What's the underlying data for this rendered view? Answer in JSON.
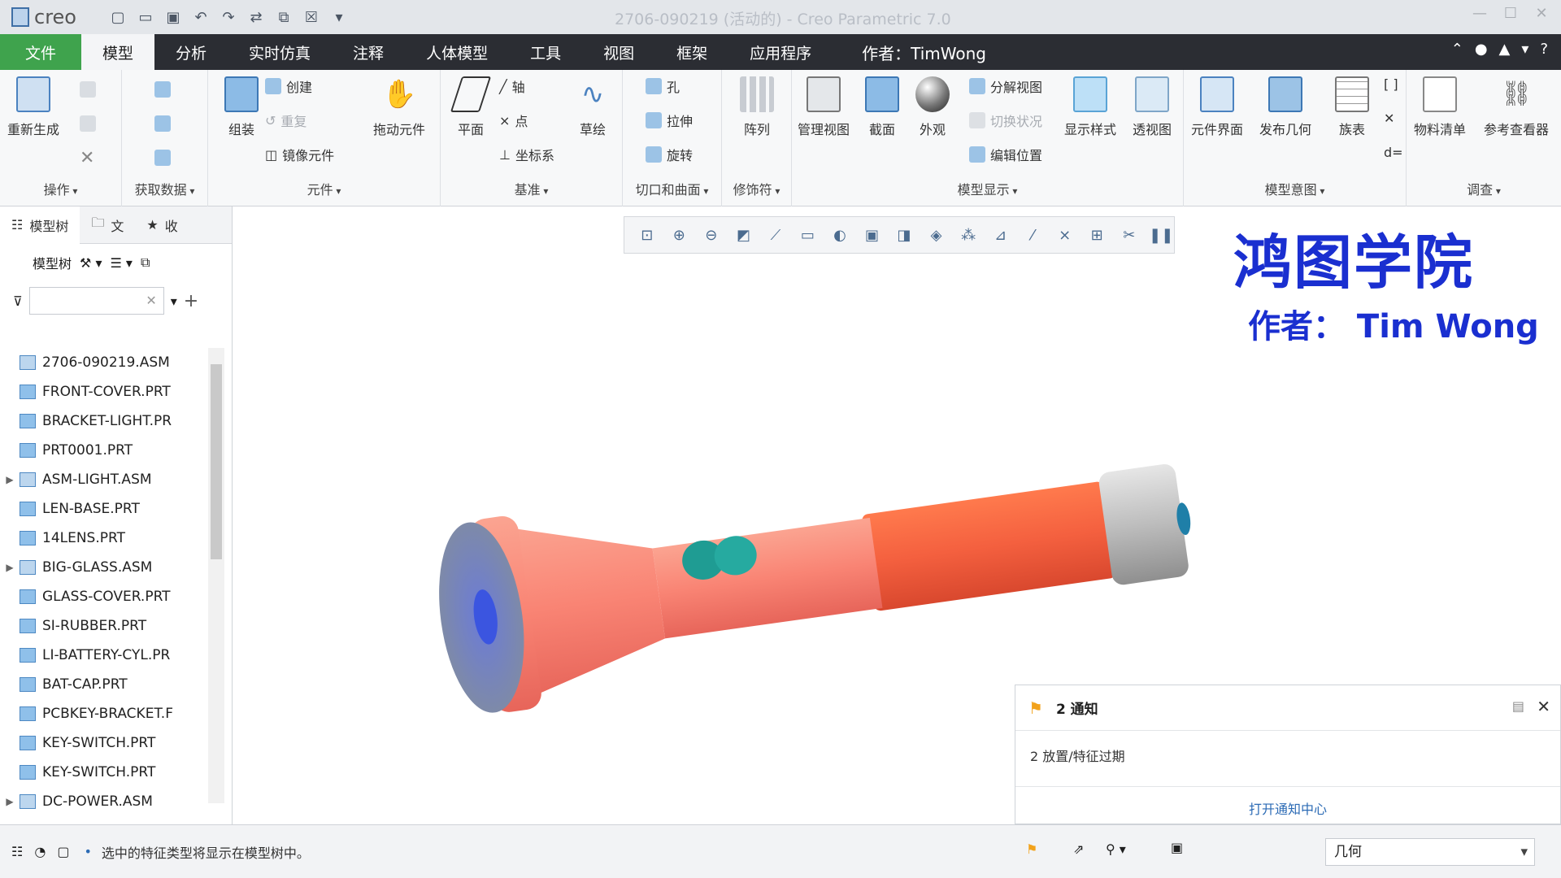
{
  "app": {
    "logo_text": "creo",
    "window_title": "2706-090219 (活动的) - Creo Parametric 7.0"
  },
  "menu": {
    "tabs": [
      "文件",
      "模型",
      "分析",
      "实时仿真",
      "注释",
      "人体模型",
      "工具",
      "视图",
      "框架",
      "应用程序"
    ],
    "author": "作者：TimWong"
  },
  "ribbon": {
    "groups": {
      "operations": {
        "label": "操作",
        "regenerate": "重新生成"
      },
      "get_data": {
        "label": "获取数据"
      },
      "component": {
        "label": "元件",
        "assemble": "组装",
        "create": "创建",
        "repeat": "重复",
        "mirror": "镜像元件",
        "drag": "拖动元件"
      },
      "datum": {
        "label": "基准",
        "plane": "平面",
        "axis": "轴",
        "point": "点",
        "csys": "坐标系",
        "sketch": "草绘"
      },
      "cut_surface": {
        "label": "切口和曲面",
        "hole": "孔",
        "extrude": "拉伸",
        "revolve": "旋转"
      },
      "modifier": {
        "label": "修饰符",
        "pattern": "阵列"
      },
      "model_display": {
        "label": "模型显示",
        "manage_views": "管理视图",
        "section": "截面",
        "appearance": "外观",
        "explode": "分解视图",
        "toggle_state": "切换状况",
        "edit_position": "编辑位置",
        "display_style": "显示样式",
        "perspective": "透视图"
      },
      "model_intent": {
        "label": "模型意图",
        "component_interface": "元件界面",
        "publish_geometry": "发布几何",
        "family_table": "族表"
      },
      "investigate": {
        "label": "调查",
        "bom": "物料清单",
        "reference_viewer": "参考查看器"
      }
    }
  },
  "left_panel": {
    "tabs": [
      "模型树",
      "文",
      "收"
    ],
    "toolbar_label": "模型树",
    "tree": [
      {
        "name": "2706-090219.ASM",
        "type": "asm",
        "expand": ""
      },
      {
        "name": "FRONT-COVER.PRT",
        "type": "prt",
        "expand": ""
      },
      {
        "name": "BRACKET-LIGHT.PR",
        "type": "prt",
        "expand": ""
      },
      {
        "name": "PRT0001.PRT",
        "type": "prt",
        "expand": ""
      },
      {
        "name": "ASM-LIGHT.ASM",
        "type": "asm",
        "expand": "▶"
      },
      {
        "name": "LEN-BASE.PRT",
        "type": "prt",
        "expand": ""
      },
      {
        "name": "14LENS.PRT",
        "type": "prt",
        "expand": ""
      },
      {
        "name": "BIG-GLASS.ASM",
        "type": "asm",
        "expand": "▶"
      },
      {
        "name": "GLASS-COVER.PRT",
        "type": "prt",
        "expand": ""
      },
      {
        "name": "SI-RUBBER.PRT",
        "type": "prt",
        "expand": ""
      },
      {
        "name": "LI-BATTERY-CYL.PR",
        "type": "prt",
        "expand": ""
      },
      {
        "name": "BAT-CAP.PRT",
        "type": "prt",
        "expand": ""
      },
      {
        "name": "PCBKEY-BRACKET.F",
        "type": "prt",
        "expand": ""
      },
      {
        "name": "KEY-SWITCH.PRT",
        "type": "prt",
        "expand": ""
      },
      {
        "name": "KEY-SWITCH.PRT",
        "type": "prt",
        "expand": ""
      },
      {
        "name": "DC-POWER.ASM",
        "type": "asm",
        "expand": "▶"
      }
    ]
  },
  "viewport": {
    "brand_title": "鸿图学院",
    "brand_author": "作者： Tim Wong"
  },
  "notification": {
    "title": "2 通知",
    "message": "2 放置/特征过期",
    "link": "打开通知中心"
  },
  "status": {
    "message": "选中的特征类型将显示在模型树中。",
    "filter_value": "几何"
  },
  "colors": {
    "menu_bg": "#2b2d33",
    "file_tab": "#3fa34d",
    "brand_blue": "#1a2fd0",
    "flashlight_orange": "#f4603f",
    "flashlight_salmon": "#f98474",
    "button_teal": "#1f9c93"
  }
}
